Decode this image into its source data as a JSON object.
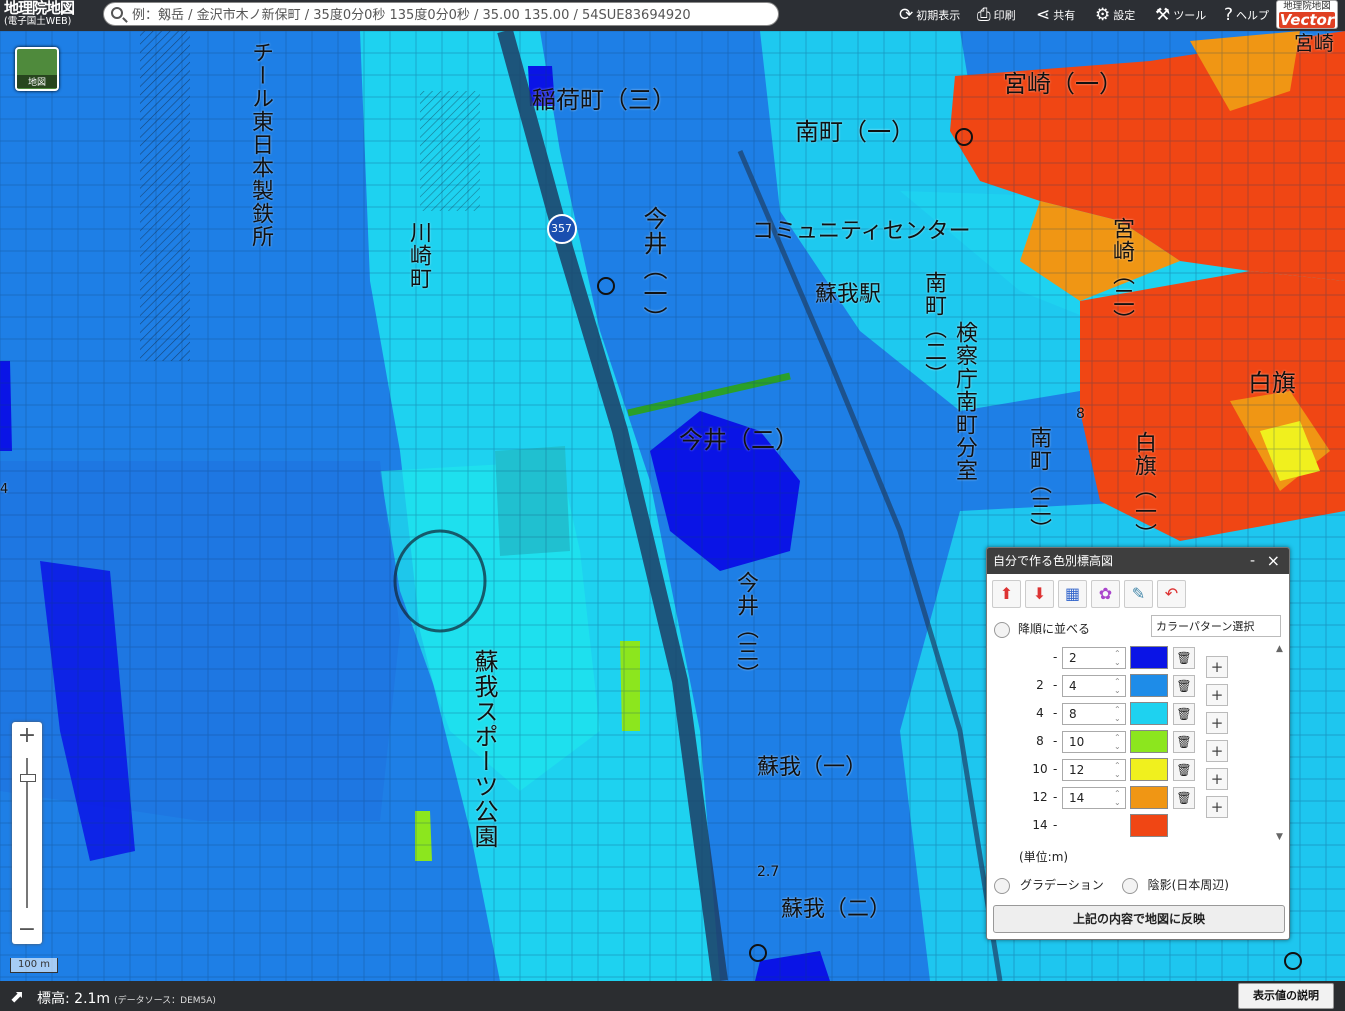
{
  "header": {
    "logo_line1": "地理院地図",
    "logo_line2": "(電子国土WEB)",
    "search_placeholder": "例：剱岳 / 金沢市木ノ新保町 / 35度0分0秒 135度0分0秒 / 35.00 135.00 / 54SUE83694920",
    "toolbar": {
      "reset": "初期表示",
      "print": "印刷",
      "share": "共有",
      "settings": "設定",
      "tools": "ツール",
      "help": "ヘルプ"
    },
    "vector_badge_top": "地理院地図",
    "vector_badge_bottom": "Vector"
  },
  "map": {
    "basemap_button_label": "地図",
    "scale_label": "100 m",
    "labels": {
      "inaricho": "稲荷町（三）",
      "minamicho1": "南町（一）",
      "miyazaki1": "宮崎（一）",
      "miyazaki2": "宮崎（二）",
      "community": "コミュニティセンター",
      "soga_station": "蘇我駅",
      "minamicho2": "南町（二）",
      "kensatsu": "検察庁南町分室",
      "imai2": "今井（二）",
      "imai1_v": "今井（一）",
      "imai3_v": "今井（三）",
      "shirahata": "白旗",
      "shirahata_v": "白旗（一）",
      "minamicho3": "南町（三）",
      "kawasaki": "川崎町",
      "jfe": "チール東日本製鉄所",
      "soga1": "蘇我（一）",
      "soga2": "蘇我（二）",
      "sports_park": "蘇我スポーツ公園",
      "route": "357",
      "elev_a": "8",
      "elev_b": "2.7",
      "edge_4": "4",
      "miyazaki_edge": "宮崎"
    }
  },
  "footer": {
    "elevation_label": "標高: 2.1m",
    "source": "(データソース：DEM5A)",
    "explain_button": "表示値の説明"
  },
  "panel": {
    "title": "自分で作る色別標高図",
    "min_label": "-",
    "close_label": "×",
    "descending_label": "降順に並べる",
    "pattern_select": "カラーパターン選択",
    "rows": [
      {
        "lo": "",
        "hi": "2",
        "color": "#0a14e6",
        "deletable": true
      },
      {
        "lo": "2",
        "hi": "4",
        "color": "#1e8ce8",
        "deletable": true
      },
      {
        "lo": "4",
        "hi": "8",
        "color": "#1ed2f0",
        "deletable": true
      },
      {
        "lo": "8",
        "hi": "10",
        "color": "#8ce61e",
        "deletable": true
      },
      {
        "lo": "10",
        "hi": "12",
        "color": "#f0f01e",
        "deletable": true
      },
      {
        "lo": "12",
        "hi": "14",
        "color": "#f09614",
        "deletable": true
      },
      {
        "lo": "14",
        "hi": "",
        "color": "#f04614",
        "deletable": false
      }
    ],
    "unit": "(単位:m)",
    "gradation": "グラデーション",
    "shading": "陰影(日本周辺)",
    "apply": "上記の内容で地図に反映"
  },
  "colors": {
    "header_bg": "#2c2f34",
    "deep_blue": "#0a14e6",
    "blue": "#1e8ce8",
    "cyan": "#1ed2f0",
    "red": "#f04614",
    "orange": "#f09614"
  }
}
